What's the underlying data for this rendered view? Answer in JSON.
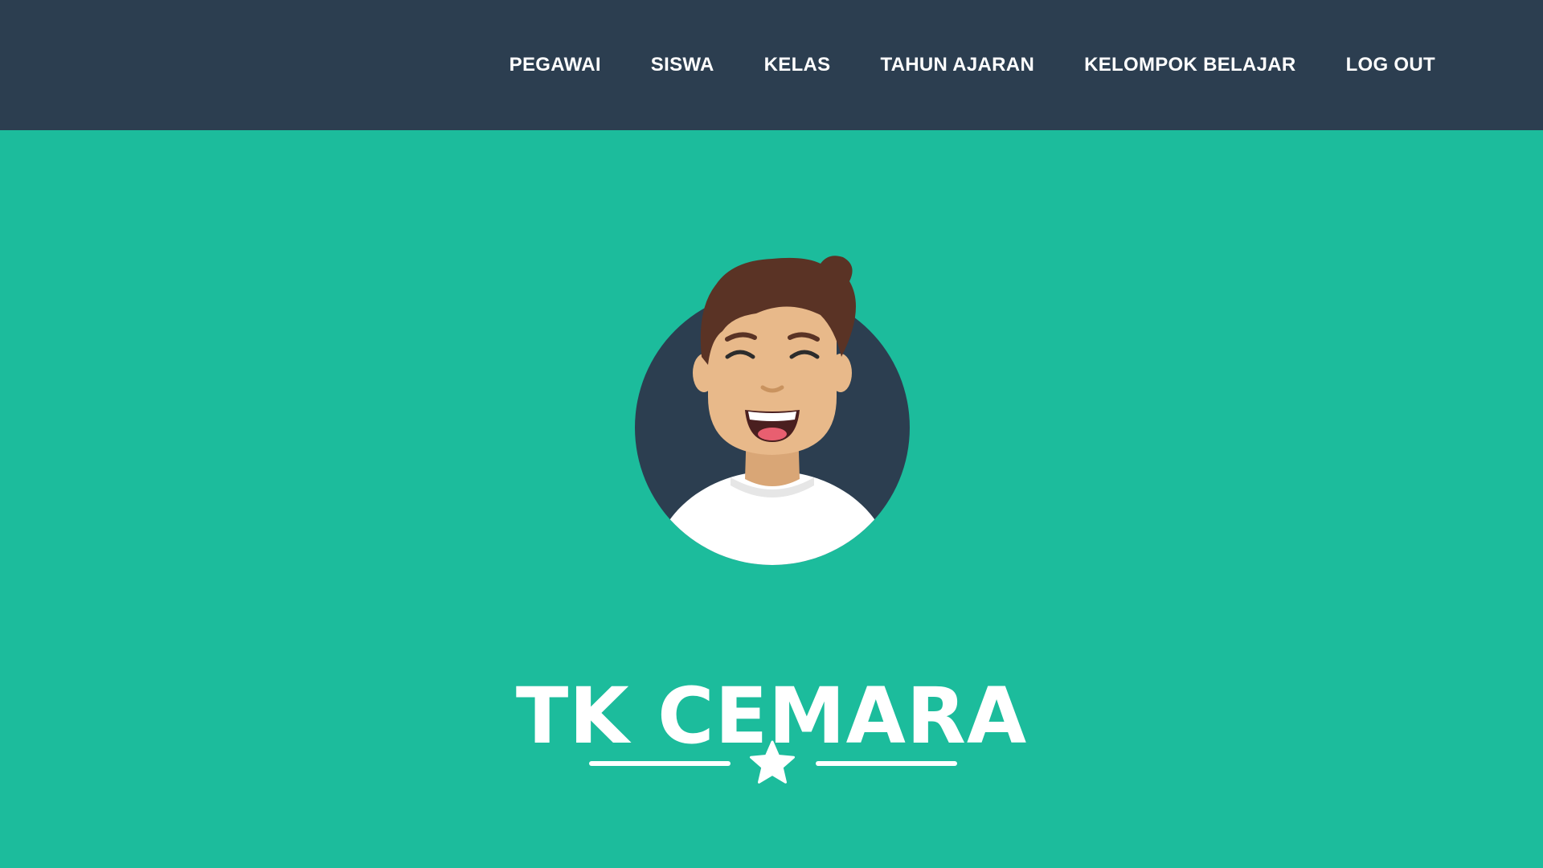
{
  "nav": {
    "items": [
      {
        "label": "PEGAWAI"
      },
      {
        "label": "SISWA"
      },
      {
        "label": "KELAS"
      },
      {
        "label": "TAHUN AJARAN"
      },
      {
        "label": "KELOMPOK BELAJAR"
      },
      {
        "label": "LOG OUT"
      }
    ]
  },
  "hero": {
    "title": "TK CEMARA",
    "avatar_icon": "smiling-boy-avatar",
    "divider_icon": "star-icon"
  },
  "colors": {
    "navbar_bg": "#2c3e50",
    "page_bg": "#1cbc9c",
    "text": "#ffffff",
    "avatar_circle": "#2c3e50",
    "skin": "#e8b98a",
    "hair": "#5a3325",
    "shirt": "#ffffff"
  }
}
